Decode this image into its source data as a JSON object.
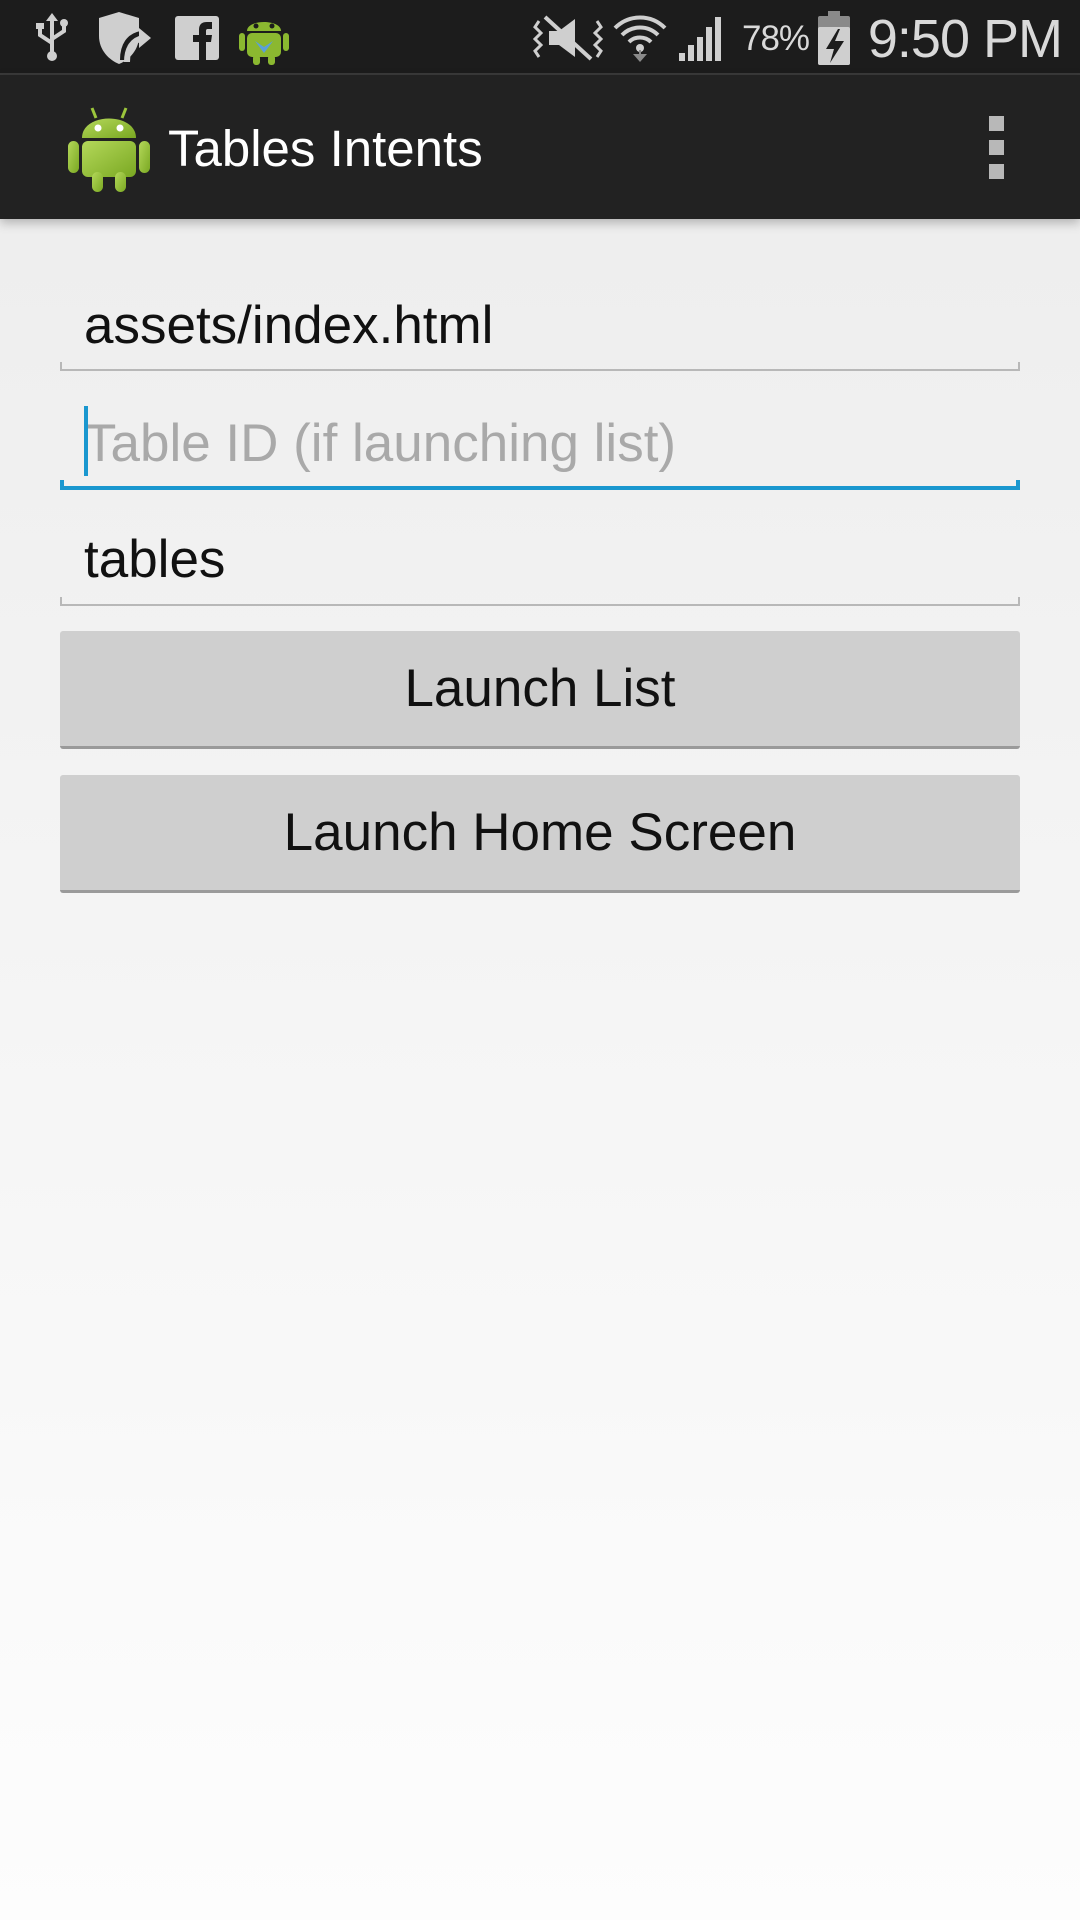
{
  "status_bar": {
    "left_icons": [
      "usb-icon",
      "shield-sync-icon",
      "facebook-icon",
      "android-bot-icon"
    ],
    "right_icons": [
      "vibrate-mute-icon",
      "wifi-icon",
      "cell-signal-icon",
      "battery-charging-icon"
    ],
    "battery": "78%",
    "time": "9:50 PM"
  },
  "action_bar": {
    "app_icon": "android-icon",
    "title": "Tables Intents",
    "overflow_icon": "overflow-menu-icon"
  },
  "form": {
    "file_path": {
      "value": "assets/index.html"
    },
    "table_id": {
      "value": "",
      "placeholder": "Table ID (if launching list)"
    },
    "app_name": {
      "value": "tables"
    },
    "launch_list_label": "Launch List",
    "launch_home_label": "Launch Home Screen"
  },
  "colors": {
    "accent": "#1a97cf",
    "action_bar": "#222222",
    "status_bar": "#1c1c1c",
    "button": "#cfcfcf"
  }
}
